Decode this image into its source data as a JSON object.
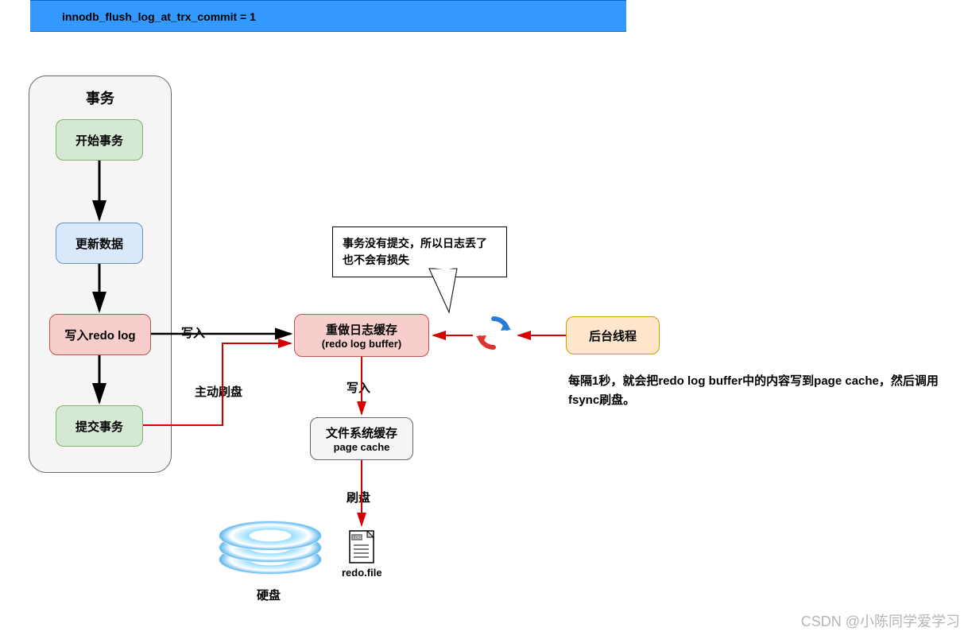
{
  "header": {
    "text": "innodb_flush_log_at_trx_commit = 1"
  },
  "tx_group": {
    "title": "事务",
    "begin": "开始事务",
    "update": "更新数据",
    "write_redo": "写入redo log",
    "commit": "提交事务"
  },
  "edges": {
    "write_in": "写入",
    "active_flush": "主动刷盘",
    "write_in2": "写入",
    "flush_disk": "刷盘"
  },
  "redo_buffer": {
    "line1": "重做日志缓存",
    "line2": "(redo log buffer)"
  },
  "page_cache": {
    "line1": "文件系统缓存",
    "line2": "page cache"
  },
  "bg_thread": "后台线程",
  "bg_desc": "每隔1秒，就会把redo log buffer中的内容写到page cache，然后调用fsync刷盘。",
  "callout": "事务没有提交，所以日志丢了也不会有损失",
  "disk": {
    "label": "硬盘",
    "file": "redo.file"
  },
  "watermark": "CSDN @小陈同学爱学习"
}
